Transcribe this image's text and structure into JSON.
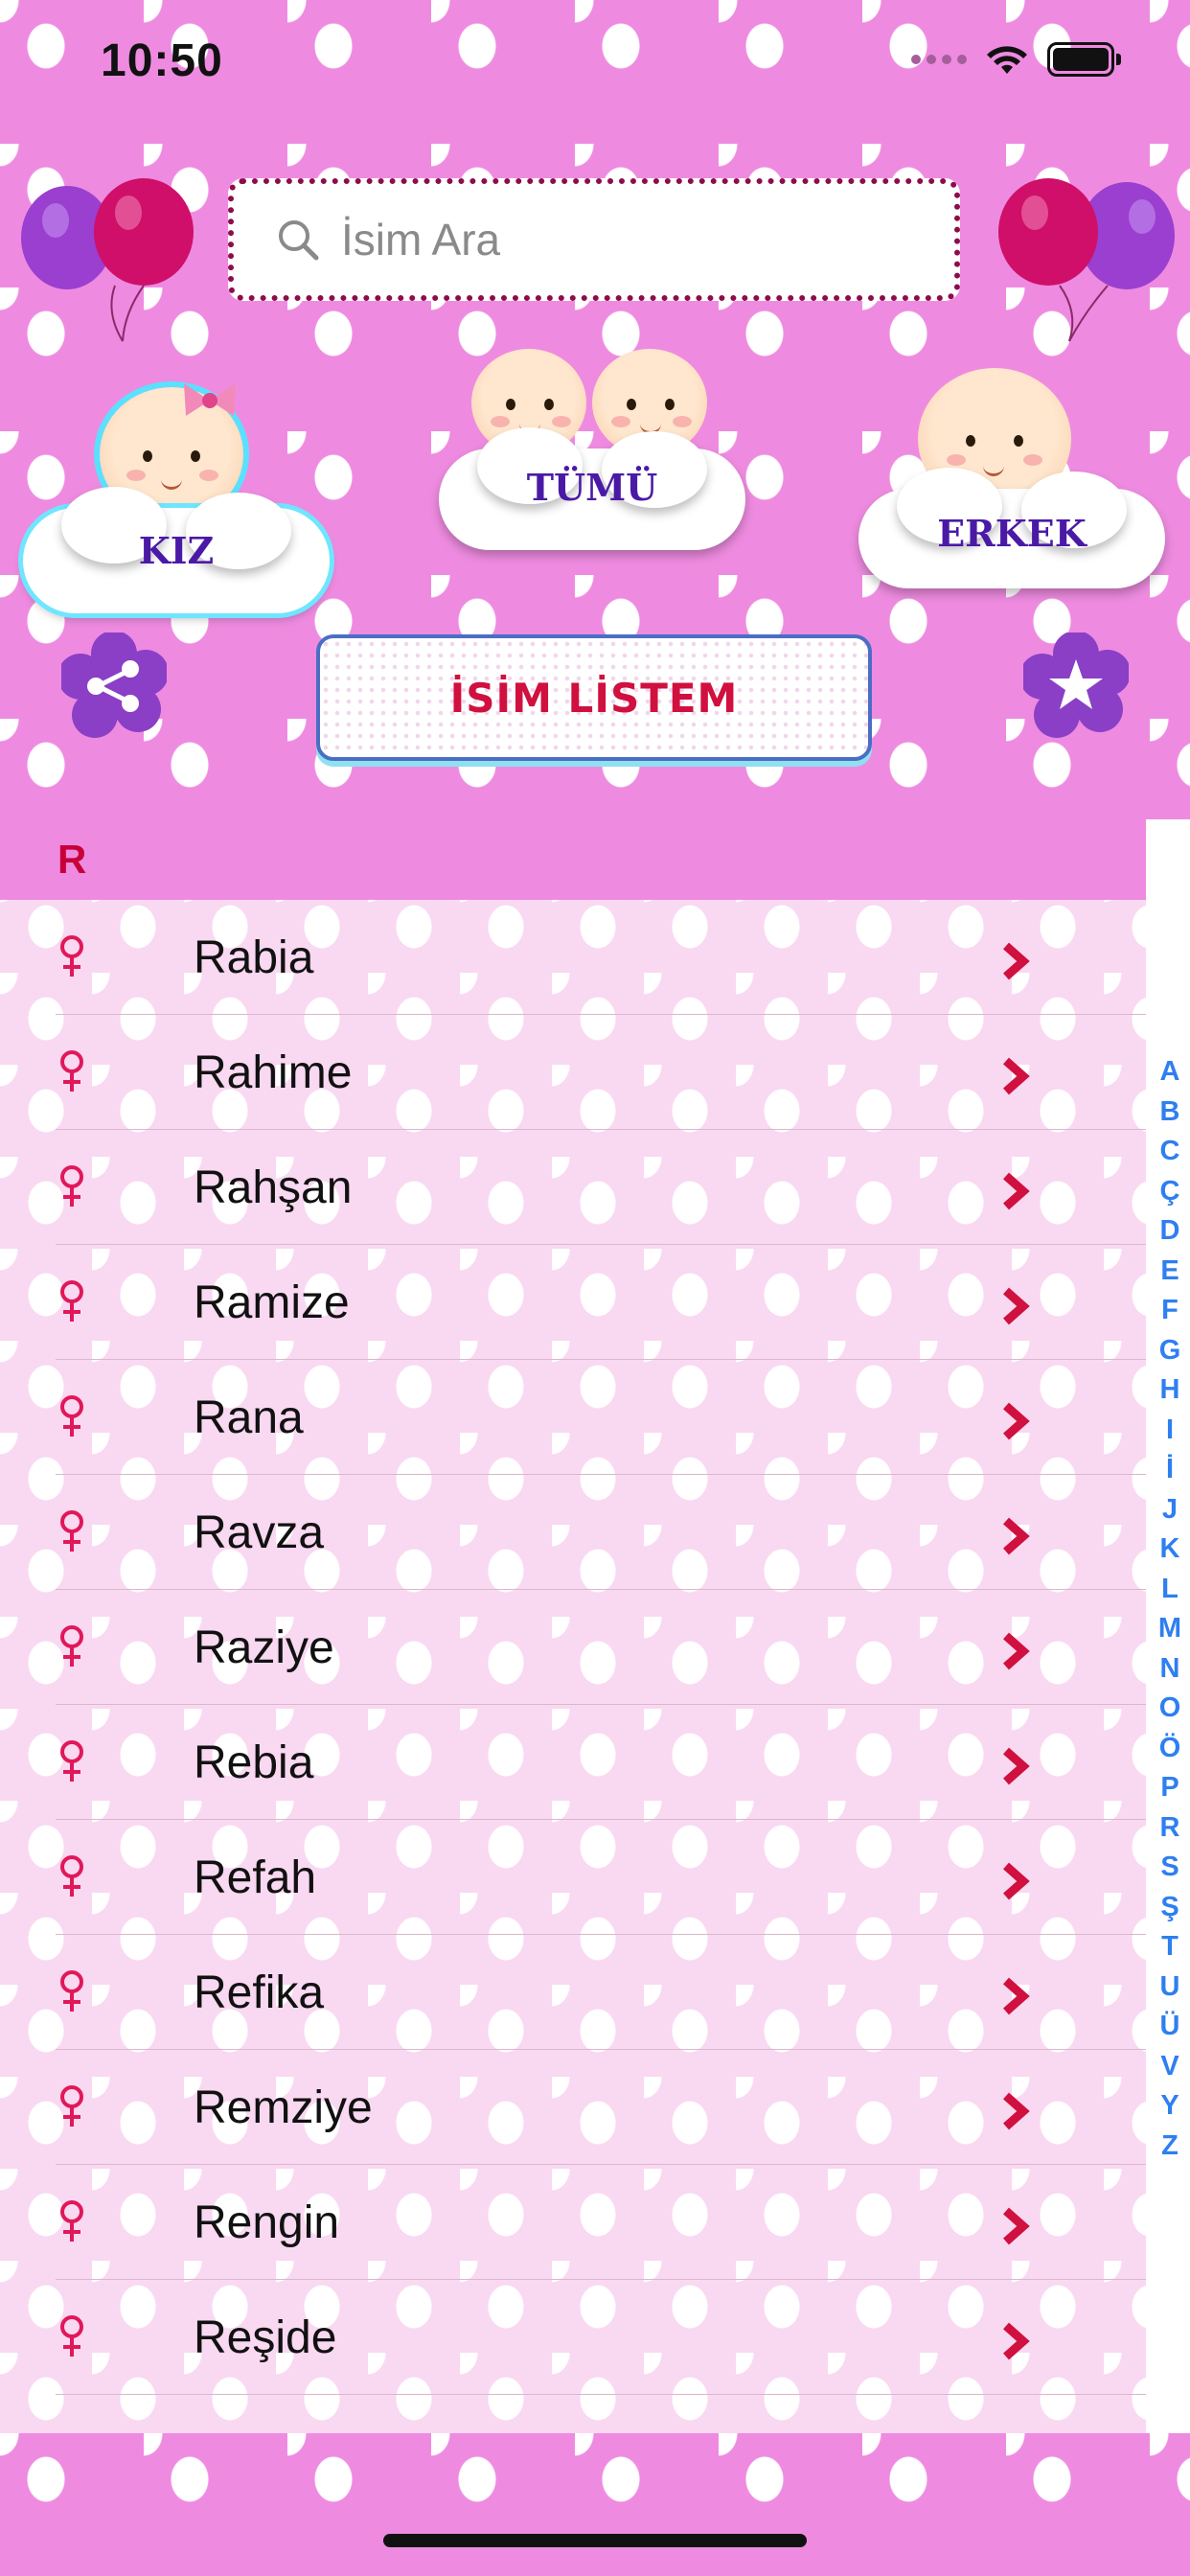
{
  "status_bar": {
    "time": "10:50"
  },
  "search": {
    "placeholder": "İsim Ara"
  },
  "categories": {
    "girl": "KIZ",
    "all": "TÜMÜ",
    "boy": "ERKEK"
  },
  "list_button": {
    "label": "İSİM LİSTEM"
  },
  "section": {
    "letter": "R"
  },
  "names": [
    "Rabia",
    "Rahime",
    "Rahşan",
    "Ramize",
    "Rana",
    "Ravza",
    "Raziye",
    "Rebia",
    "Refah",
    "Refika",
    "Remziye",
    "Rengin",
    "Reşide"
  ],
  "index_letters": [
    "A",
    "B",
    "C",
    "Ç",
    "D",
    "E",
    "F",
    "G",
    "H",
    "I",
    "İ",
    "J",
    "K",
    "L",
    "M",
    "N",
    "O",
    "Ö",
    "P",
    "R",
    "S",
    "Ş",
    "T",
    "U",
    "Ü",
    "V",
    "Y",
    "Z"
  ],
  "colors": {
    "background_pink": "#ee8be0",
    "list_pink": "#f9d8f1",
    "accent_red": "#d0103f",
    "category_purple": "#4a1aa6",
    "index_blue": "#2e7ff0"
  },
  "icons": {
    "search": "search-icon",
    "share": "share-icon",
    "favorites": "star-icon",
    "gender": "female-icon",
    "row_disclosure": "chevron-right-icon"
  }
}
